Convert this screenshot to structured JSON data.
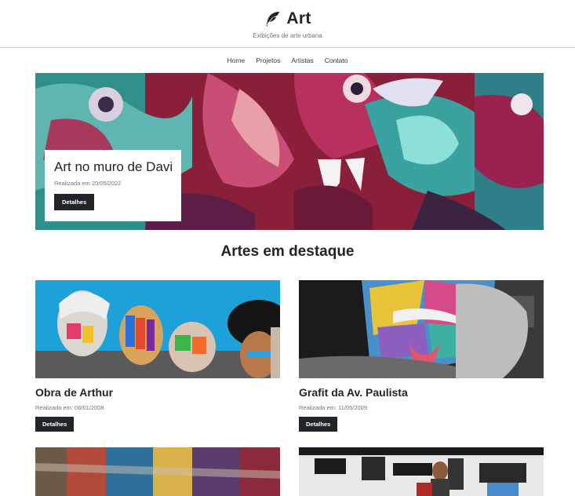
{
  "header": {
    "title": "Art",
    "tagline": "Exibições de arte urbana",
    "logo_icon": "feather-icon"
  },
  "nav": {
    "items": [
      {
        "label": "Home"
      },
      {
        "label": "Projetos"
      },
      {
        "label": "Artistas"
      },
      {
        "label": "Contato"
      }
    ]
  },
  "hero": {
    "title": "Art no muro de Davi",
    "date": "Realizada em 20/05/2022",
    "button": "Detalhes"
  },
  "featured": {
    "heading": "Artes em destaque",
    "cards": [
      {
        "title": "Obra de Arthur",
        "date": "Realizada em: 06/01/2008",
        "button": "Detalhes"
      },
      {
        "title": "Grafit da Av. Paulista",
        "date": "Realizada em: 11/05/2009",
        "button": "Detalhes"
      }
    ]
  },
  "colors": {
    "button_bg": "#212529",
    "text_muted": "#6c757d"
  }
}
